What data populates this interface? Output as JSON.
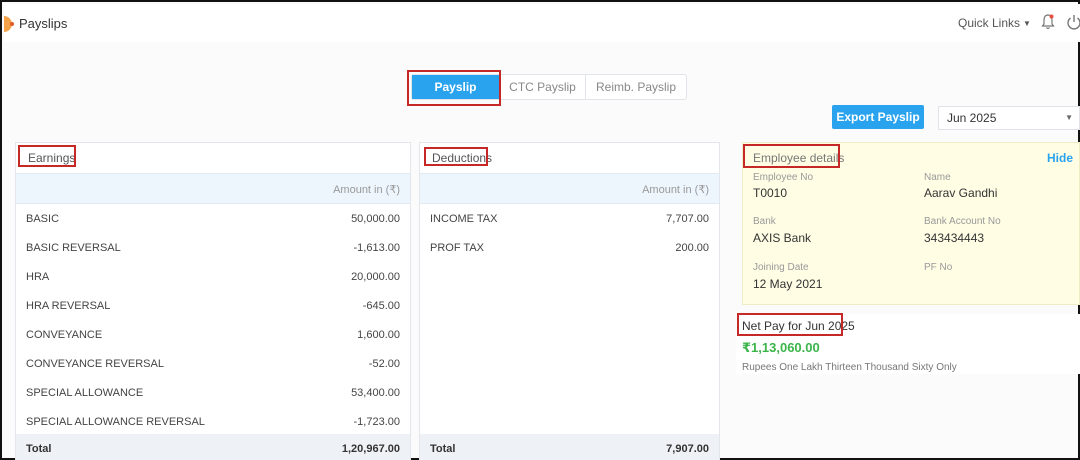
{
  "app": {
    "title": "Payslips"
  },
  "header": {
    "quick_links": "Quick Links"
  },
  "tabs": [
    {
      "label": "Payslip",
      "active": true
    },
    {
      "label": "CTC Payslip",
      "active": false
    },
    {
      "label": "Reimb. Payslip",
      "active": false
    }
  ],
  "toolbar": {
    "export_label": "Export Payslip",
    "period": "Jun 2025"
  },
  "earnings": {
    "title": "Earnings",
    "amount_header": "Amount in (₹)",
    "rows": [
      {
        "label": "BASIC",
        "amount": "50,000.00"
      },
      {
        "label": "BASIC REVERSAL",
        "amount": "-1,613.00"
      },
      {
        "label": "HRA",
        "amount": "20,000.00"
      },
      {
        "label": "HRA REVERSAL",
        "amount": "-645.00"
      },
      {
        "label": "CONVEYANCE",
        "amount": "1,600.00"
      },
      {
        "label": "CONVEYANCE REVERSAL",
        "amount": "-52.00"
      },
      {
        "label": "SPECIAL ALLOWANCE",
        "amount": "53,400.00"
      },
      {
        "label": "SPECIAL ALLOWANCE REVERSAL",
        "amount": "-1,723.00"
      }
    ],
    "total_label": "Total",
    "total": "1,20,967.00"
  },
  "deductions": {
    "title": "Deductions",
    "amount_header": "Amount in (₹)",
    "rows": [
      {
        "label": "INCOME TAX",
        "amount": "7,707.00"
      },
      {
        "label": "PROF TAX",
        "amount": "200.00"
      }
    ],
    "total_label": "Total",
    "total": "7,907.00"
  },
  "employee": {
    "title": "Employee details",
    "hide_label": "Hide",
    "employee_no_label": "Employee No",
    "employee_no": "T0010",
    "name_label": "Name",
    "name": "Aarav Gandhi",
    "bank_label": "Bank",
    "bank": "AXIS Bank",
    "bank_account_label": "Bank Account No",
    "bank_account": "343434443",
    "joining_label": "Joining Date",
    "joining": "12 May 2021",
    "pf_label": "PF No"
  },
  "netpay": {
    "title": "Net Pay for Jun 2025",
    "amount": "₹1,13,060.00",
    "words": "Rupees One Lakh Thirteen Thousand Sixty Only"
  },
  "colors": {
    "accent": "#2aa3ef",
    "positive": "#3bb54a",
    "highlight": "#c62828"
  }
}
